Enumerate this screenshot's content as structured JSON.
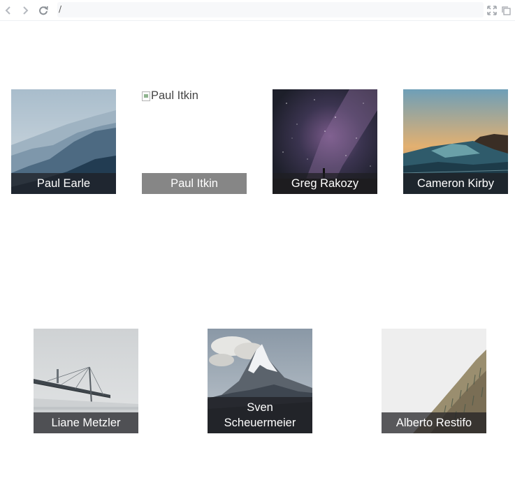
{
  "browser": {
    "url": "/",
    "icons": [
      "back-icon",
      "forward-icon",
      "refresh-icon",
      "fullscreen-icon",
      "copy-icon"
    ]
  },
  "gallery": {
    "row1": [
      {
        "caption": "Paul Earle",
        "scene": "misty-mountains"
      },
      {
        "caption": "Paul Itkin",
        "alt": "Paul Itkin",
        "scene": "broken-image"
      },
      {
        "caption": "Greg Rakozy",
        "scene": "starry-night"
      },
      {
        "caption": "Cameron Kirby",
        "scene": "ocean-wave"
      }
    ],
    "row2": [
      {
        "caption": "Liane Metzler",
        "scene": "foggy-bridge"
      },
      {
        "caption": "Sven Scheuermeier",
        "caption_line1": "Sven",
        "caption_line2": "Scheuermeier",
        "scene": "snowy-peak"
      },
      {
        "caption": "Alberto Restifo",
        "scene": "foggy-hillside"
      }
    ]
  }
}
